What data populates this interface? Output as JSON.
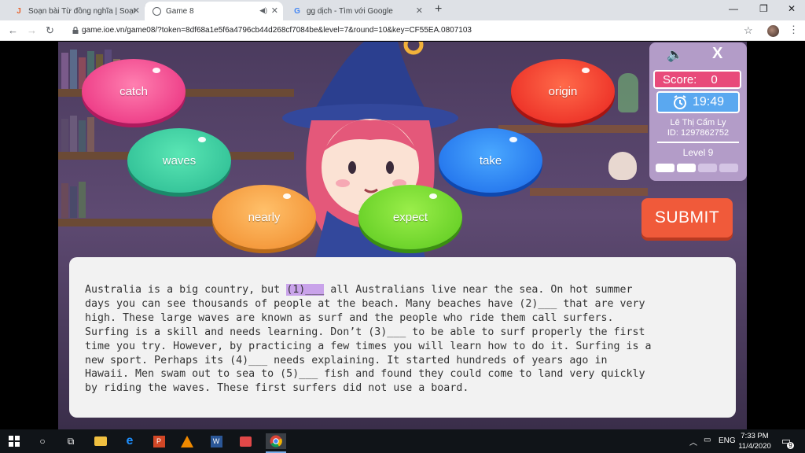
{
  "browser": {
    "tabs": [
      {
        "title": "Soạn bài Từ đồng nghĩa | Soạn vă",
        "icon": "j-site-icon"
      },
      {
        "title": "Game 8",
        "icon": "ioe-icon"
      },
      {
        "title": "gg dịch - Tìm với Google",
        "icon": "google-icon"
      }
    ],
    "url": "game.ioe.vn/game08/?token=8df68a1e5f6a4796cb44d268cf7084be&level=7&round=10&key=CF55EA.0807103"
  },
  "game": {
    "words": [
      "catch",
      "origin",
      "waves",
      "take",
      "nearly",
      "expect"
    ],
    "score_label": "Score:",
    "score_value": "0",
    "time": "19:49",
    "player_name": "Lê Thị Cẩm Ly",
    "player_id": "ID: 1297862752",
    "level": "Level 9",
    "submit_label": "SUBMIT",
    "close_label": "X",
    "progress_segments": 4,
    "progress_filled": 2
  },
  "passage": {
    "before": "Australia is a big country, but ",
    "blank": "(1)___",
    "after": " all Australians live near the sea. On hot summer\ndays you can see thousands of people at the beach. Many beaches have (2)___ that are very\nhigh. These large waves are known as surf and the people who ride them call surfers.\nSurfing is a skill and needs learning. Don’t (3)___ to be able to surf properly the first\ntime you try. However, by practicing a few times you will learn how to do it. Surfing is a\nnew sport. Perhaps its (4)___ needs explaining. It started hundreds of years ago in\nHawaii. Men swam out to sea to (5)___ fish and found they could come to land very quickly\nby riding the waves. These first surfers did not use a board."
  },
  "taskbar": {
    "lang": "ENG",
    "time": "7:33 PM",
    "date": "11/4/2020",
    "notif_count": "9"
  }
}
